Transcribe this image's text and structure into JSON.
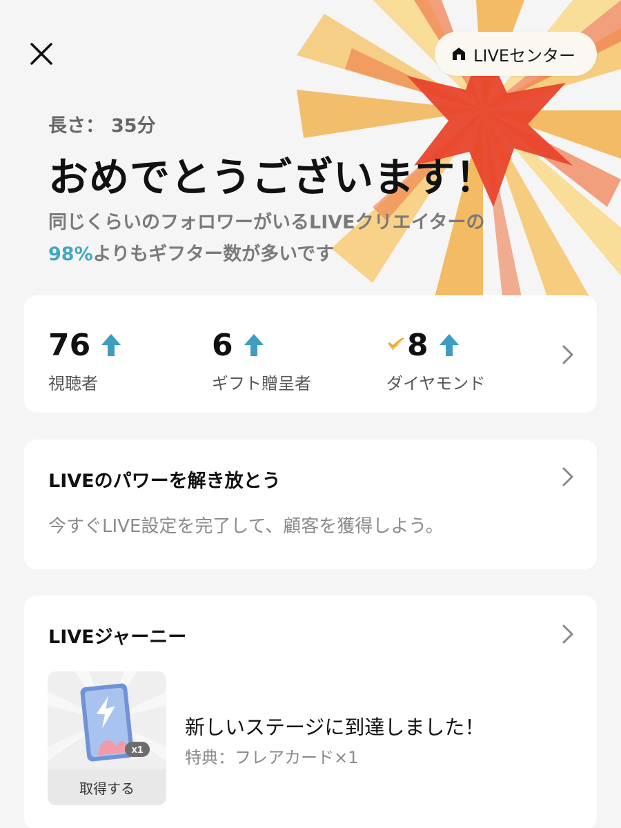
{
  "header": {
    "live_center_label": "LIVEセンター"
  },
  "summary": {
    "duration_label": "長さ：",
    "duration_value": "35分",
    "headline": "おめでとうございます！",
    "subtext_line1": "同じくらいのフォロワーがいるLIVEクリエイターの",
    "subtext_percent": "98%",
    "subtext_line2_rest": "よりもギフター数が多いです"
  },
  "stats": [
    {
      "value": "76",
      "label": "視聴者",
      "trend": "up"
    },
    {
      "value": "6",
      "label": "ギフト贈呈者",
      "trend": "up"
    },
    {
      "value": "8",
      "label": "ダイヤモンド",
      "trend": "up",
      "icon": "diamond-icon"
    }
  ],
  "power_card": {
    "title": "LIVEのパワーを解き放とう",
    "description": "今すぐLIVE設定を完了して、顧客を獲得しよう。"
  },
  "journey_card": {
    "title": "LIVEジャーニー",
    "reward_badge": "x1",
    "claim_label": "取得する",
    "reward_title": "新しいステージに到達しました！",
    "reward_subtitle": "特典：フレアカード×1"
  },
  "colors": {
    "accent_blue": "#3fa7c4",
    "burst_red": "#e8442b",
    "burst_orange": "#f2b04a",
    "burst_yellow": "#f9d98a"
  }
}
